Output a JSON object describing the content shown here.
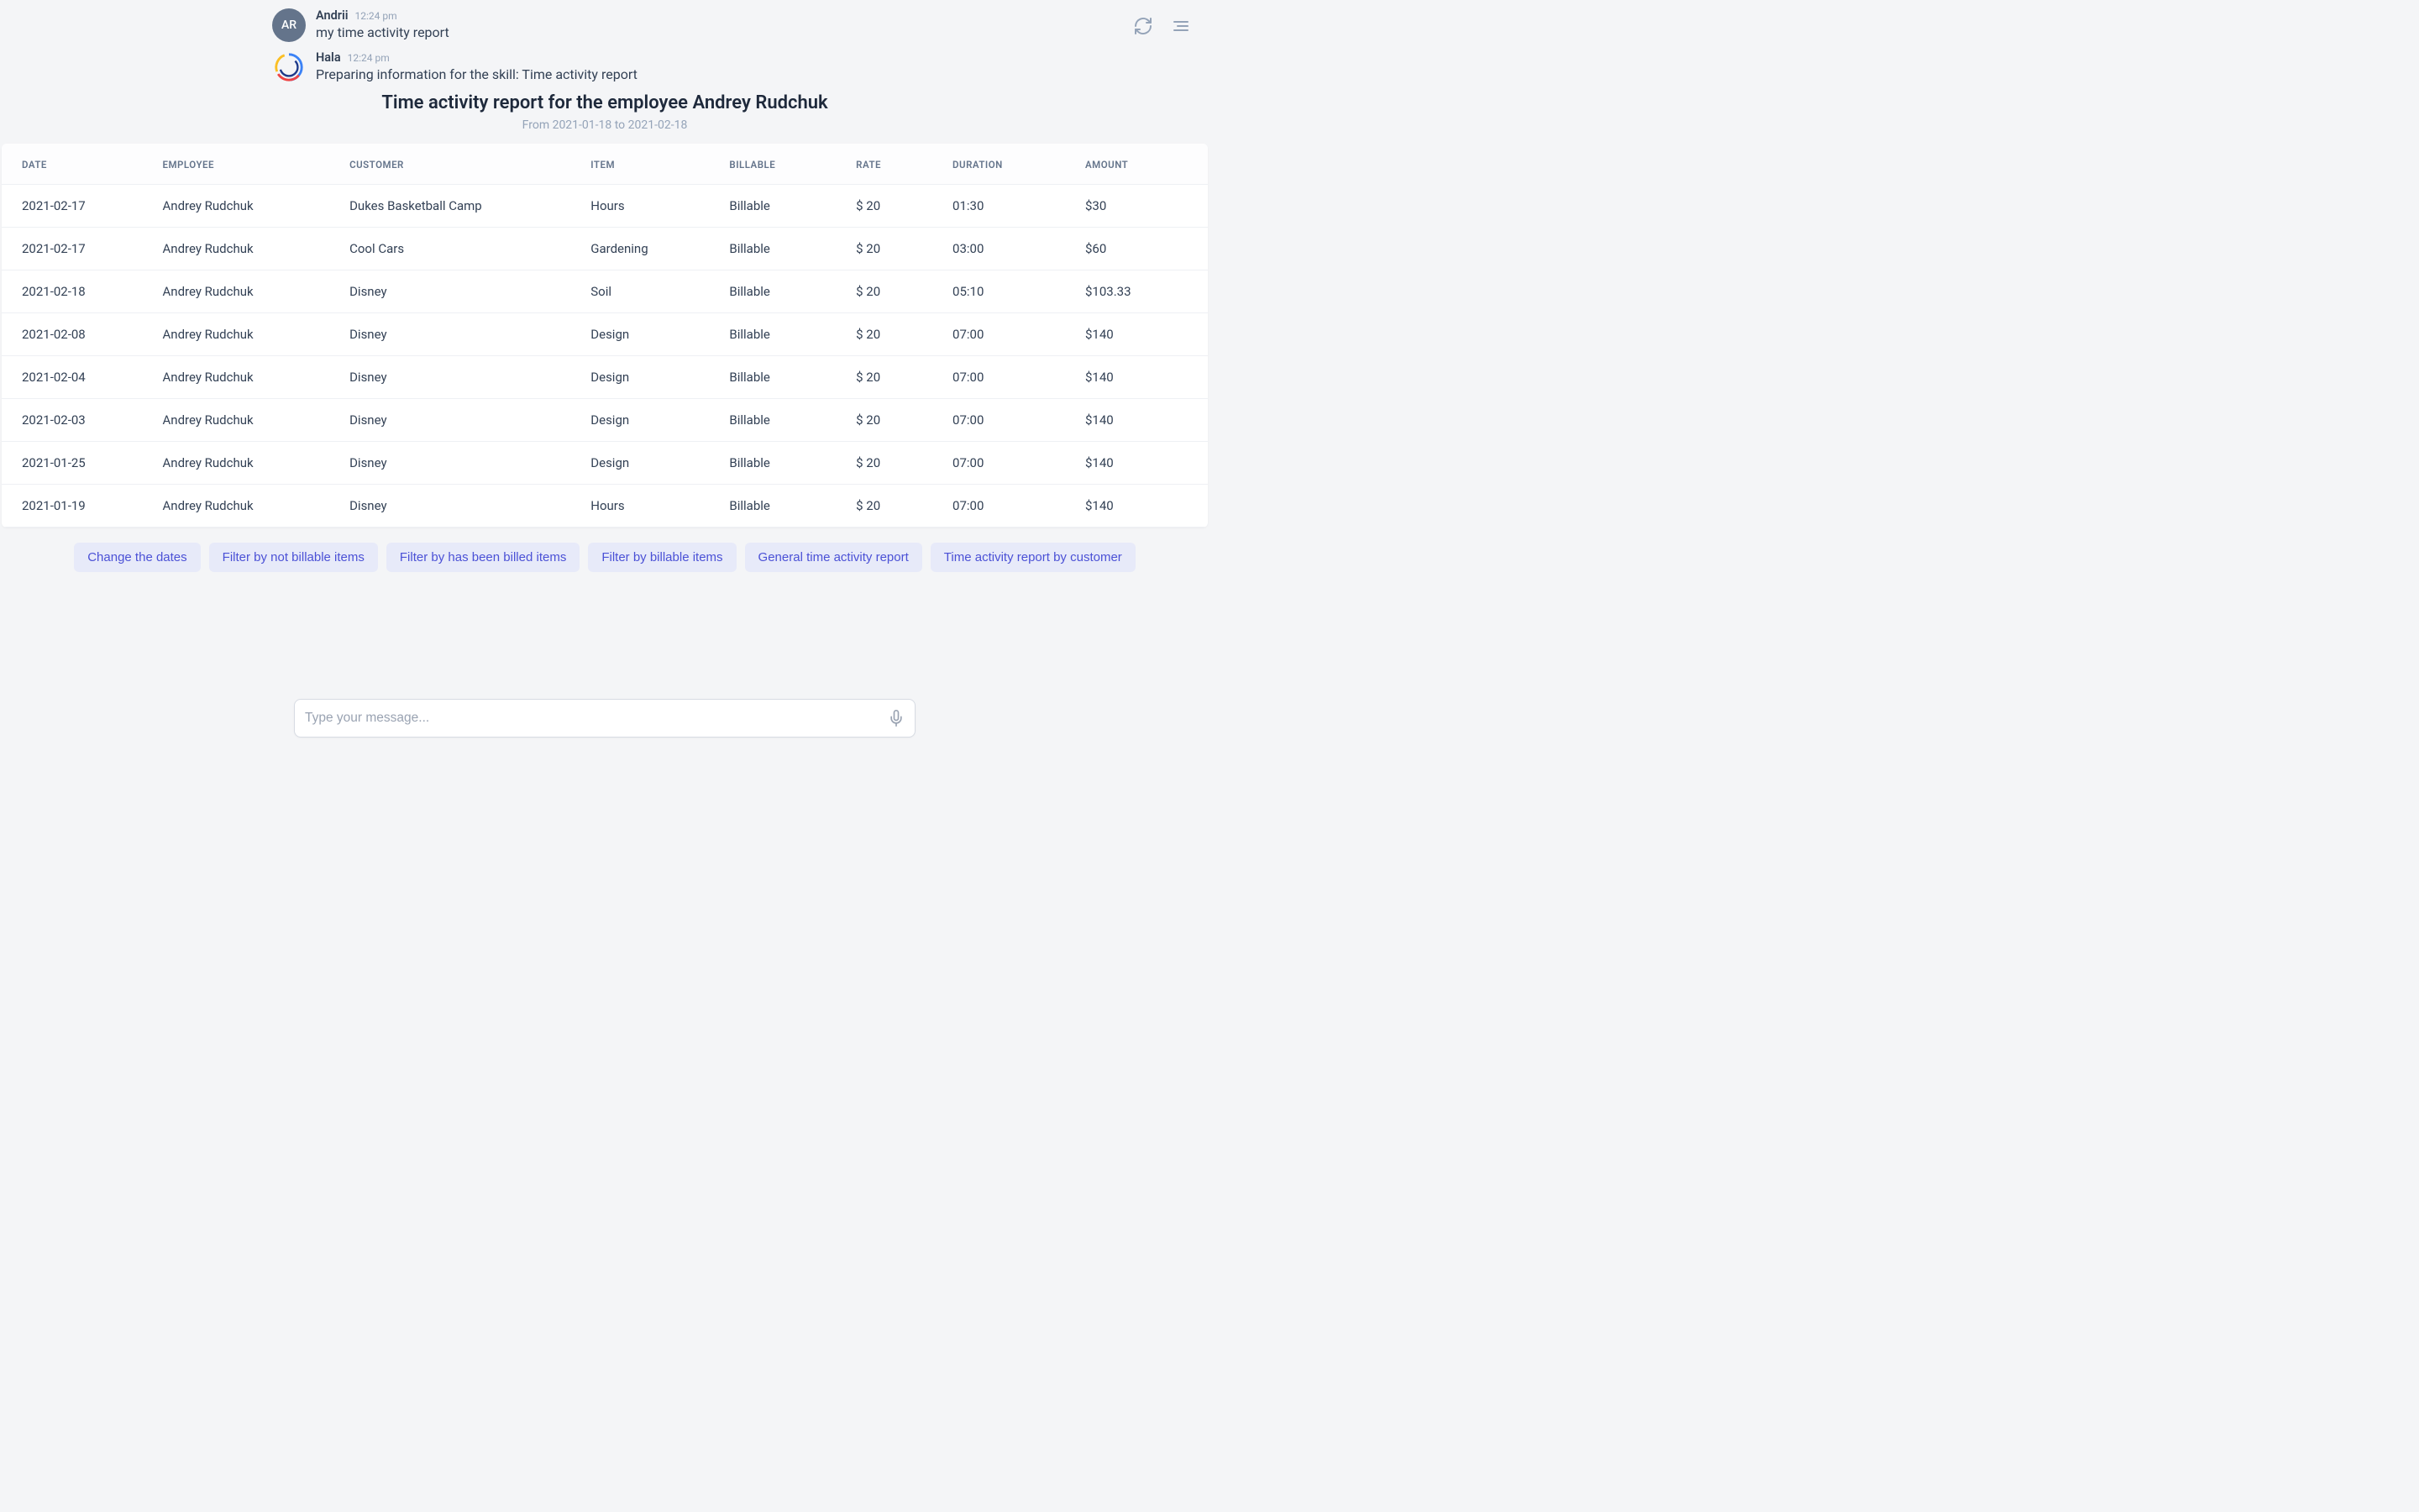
{
  "topbar": {
    "refresh_icon": "refresh",
    "menu_icon": "menu"
  },
  "user_message": {
    "avatar": "AR",
    "name": "Andrii",
    "time": "12:24 pm",
    "text": "my time activity report"
  },
  "bot_message": {
    "name": "Hala",
    "time": "12:24 pm",
    "text": "Preparing information for the skill: Time activity report"
  },
  "report": {
    "title": "Time activity report for the employee Andrey Rudchuk",
    "subtitle": "From 2021-01-18 to 2021-02-18",
    "columns": [
      "DATE",
      "EMPLOYEE",
      "CUSTOMER",
      "ITEM",
      "BILLABLE",
      "RATE",
      "DURATION",
      "AMOUNT"
    ],
    "rows": [
      {
        "date": "2021-02-17",
        "employee": "Andrey Rudchuk",
        "customer": "Dukes Basketball Camp",
        "item": "Hours",
        "billable": "Billable",
        "rate": "$ 20",
        "duration": "01:30",
        "amount": "$30"
      },
      {
        "date": "2021-02-17",
        "employee": "Andrey Rudchuk",
        "customer": "Cool Cars",
        "item": "Gardening",
        "billable": "Billable",
        "rate": "$ 20",
        "duration": "03:00",
        "amount": "$60"
      },
      {
        "date": "2021-02-18",
        "employee": "Andrey Rudchuk",
        "customer": "Disney",
        "item": "Soil",
        "billable": "Billable",
        "rate": "$ 20",
        "duration": "05:10",
        "amount": "$103.33"
      },
      {
        "date": "2021-02-08",
        "employee": "Andrey Rudchuk",
        "customer": "Disney",
        "item": "Design",
        "billable": "Billable",
        "rate": "$ 20",
        "duration": "07:00",
        "amount": "$140"
      },
      {
        "date": "2021-02-04",
        "employee": "Andrey Rudchuk",
        "customer": "Disney",
        "item": "Design",
        "billable": "Billable",
        "rate": "$ 20",
        "duration": "07:00",
        "amount": "$140"
      },
      {
        "date": "2021-02-03",
        "employee": "Andrey Rudchuk",
        "customer": "Disney",
        "item": "Design",
        "billable": "Billable",
        "rate": "$ 20",
        "duration": "07:00",
        "amount": "$140"
      },
      {
        "date": "2021-01-25",
        "employee": "Andrey Rudchuk",
        "customer": "Disney",
        "item": "Design",
        "billable": "Billable",
        "rate": "$ 20",
        "duration": "07:00",
        "amount": "$140"
      },
      {
        "date": "2021-01-19",
        "employee": "Andrey Rudchuk",
        "customer": "Disney",
        "item": "Hours",
        "billable": "Billable",
        "rate": "$ 20",
        "duration": "07:00",
        "amount": "$140"
      }
    ]
  },
  "actions": [
    "Change the dates",
    "Filter by not billable items",
    "Filter by has been billed items",
    "Filter by billable items",
    "General time activity report",
    "Time activity report by customer"
  ],
  "input": {
    "placeholder": "Type your message..."
  }
}
